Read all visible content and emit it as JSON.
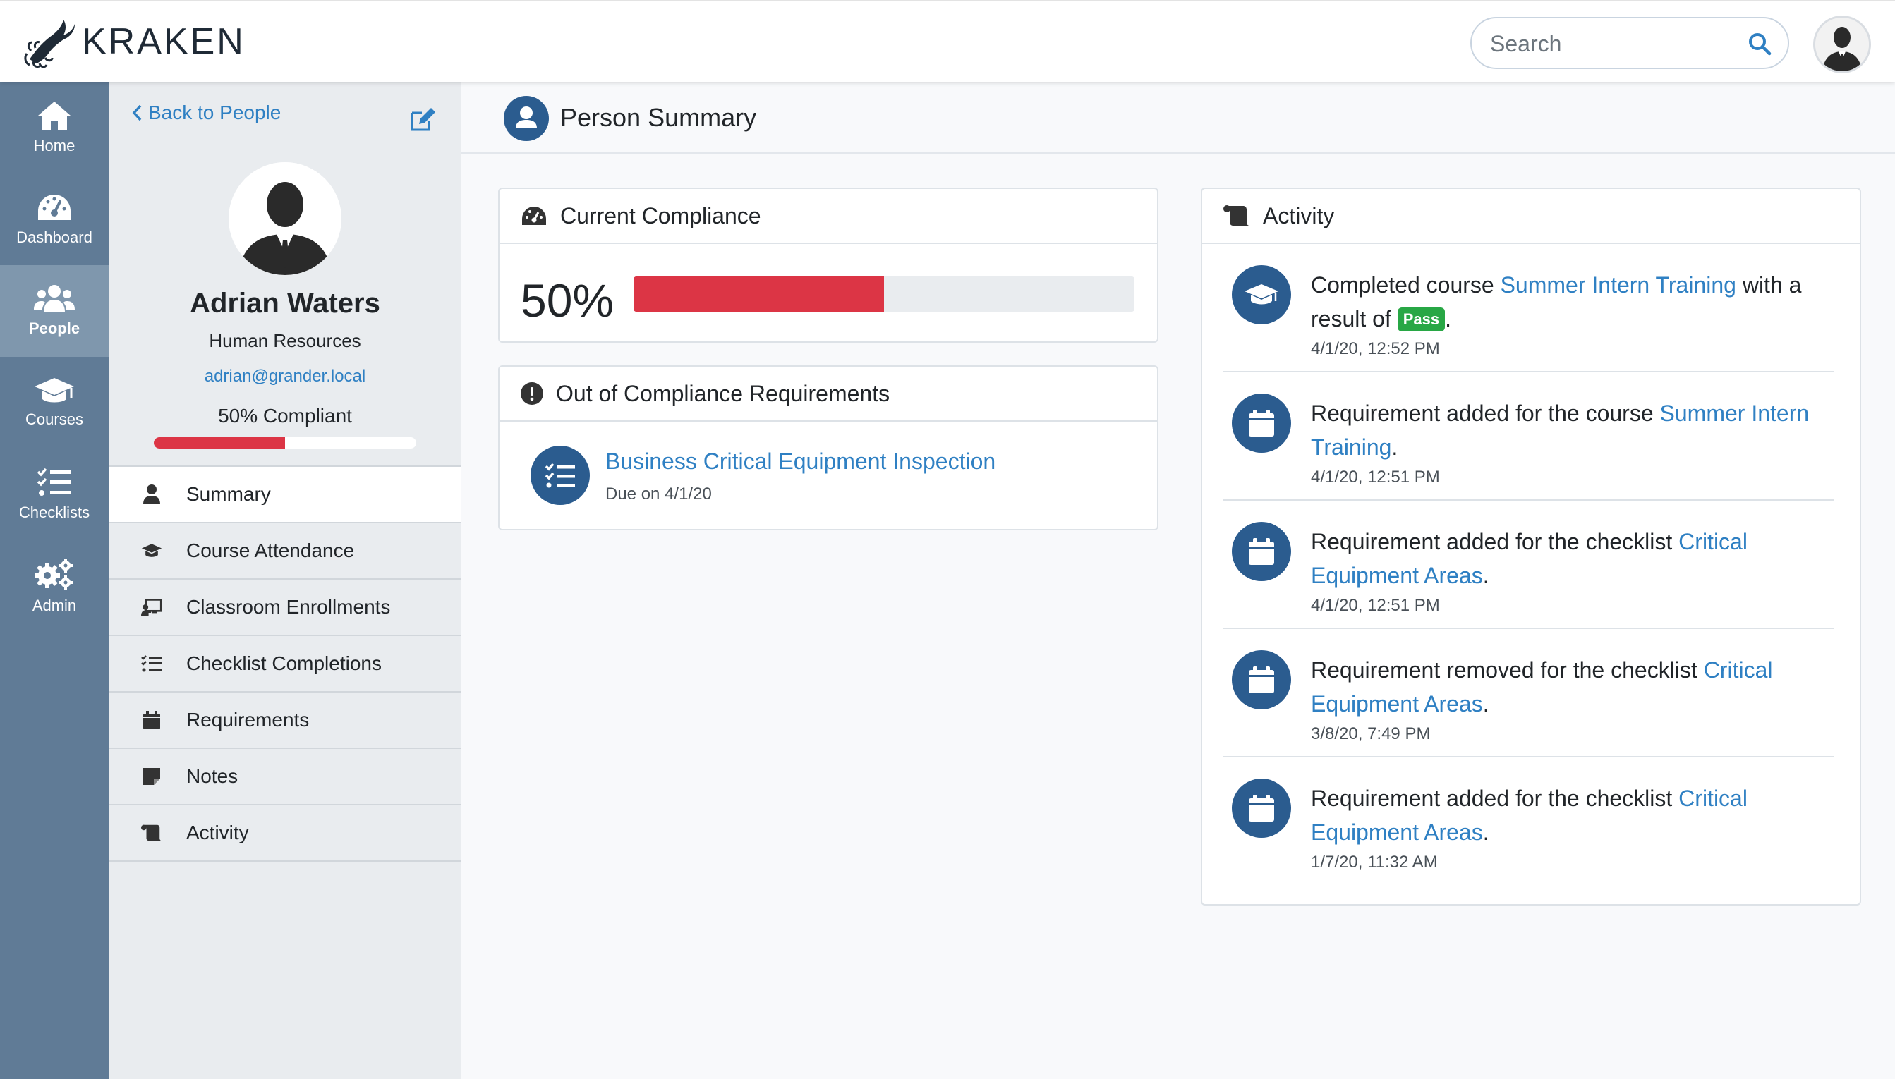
{
  "app": {
    "name": "KRAKEN"
  },
  "search": {
    "placeholder": "Search"
  },
  "nav": {
    "items": [
      {
        "label": "Home",
        "icon": "home-icon"
      },
      {
        "label": "Dashboard",
        "icon": "dashboard-icon"
      },
      {
        "label": "People",
        "icon": "people-icon",
        "active": true
      },
      {
        "label": "Courses",
        "icon": "graduation-cap-icon"
      },
      {
        "label": "Checklists",
        "icon": "checklist-icon"
      },
      {
        "label": "Admin",
        "icon": "gears-icon"
      }
    ]
  },
  "person": {
    "back_label": "Back to People",
    "name": "Adrian Waters",
    "department": "Human Resources",
    "email": "adrian@grander.local",
    "compliance_label": "50% Compliant",
    "compliance_fraction": 0.5
  },
  "submenu": {
    "items": [
      {
        "label": "Summary",
        "icon": "user-icon",
        "active": true
      },
      {
        "label": "Course Attendance",
        "icon": "graduation-cap-icon"
      },
      {
        "label": "Classroom Enrollments",
        "icon": "chalkboard-teacher-icon"
      },
      {
        "label": "Checklist Completions",
        "icon": "tasks-icon"
      },
      {
        "label": "Requirements",
        "icon": "calendar-icon"
      },
      {
        "label": "Notes",
        "icon": "sticky-note-icon"
      },
      {
        "label": "Activity",
        "icon": "scroll-icon"
      }
    ]
  },
  "page": {
    "title": "Person Summary"
  },
  "compliance": {
    "title": "Current Compliance",
    "percent_label": "50%",
    "fraction": 0.5
  },
  "out_of_compliance": {
    "title": "Out of Compliance Requirements",
    "items": [
      {
        "title": "Business Critical Equipment Inspection",
        "due": "Due on 4/1/20"
      }
    ]
  },
  "activity": {
    "title": "Activity",
    "items": [
      {
        "icon": "graduation-cap-icon",
        "pre": "Completed course ",
        "link": "Summer Intern Training",
        "post": " with a result of ",
        "badge": "Pass",
        "end": ".",
        "date": "4/1/20, 12:52 PM"
      },
      {
        "icon": "calendar-icon",
        "pre": "Requirement added for the course ",
        "link": "Summer Intern Training",
        "end": ".",
        "date": "4/1/20, 12:51 PM"
      },
      {
        "icon": "calendar-icon",
        "pre": "Requirement added for the checklist ",
        "link": "Critical Equipment Areas",
        "end": ".",
        "date": "4/1/20, 12:51 PM"
      },
      {
        "icon": "calendar-icon",
        "pre": "Requirement removed for the checklist ",
        "link": "Critical Equipment Areas",
        "end": ".",
        "date": "3/8/20, 7:49 PM"
      },
      {
        "icon": "calendar-icon",
        "pre": "Requirement added for the checklist ",
        "link": "Critical Equipment Areas",
        "end": ".",
        "date": "1/7/20, 11:32 AM"
      }
    ]
  },
  "colors": {
    "nav_bg": "#607b96",
    "nav_active": "#7f97ad",
    "accent": "#2f80c3",
    "icon_circle": "#2b5c8f",
    "danger": "#dc3545",
    "success": "#28a745"
  }
}
